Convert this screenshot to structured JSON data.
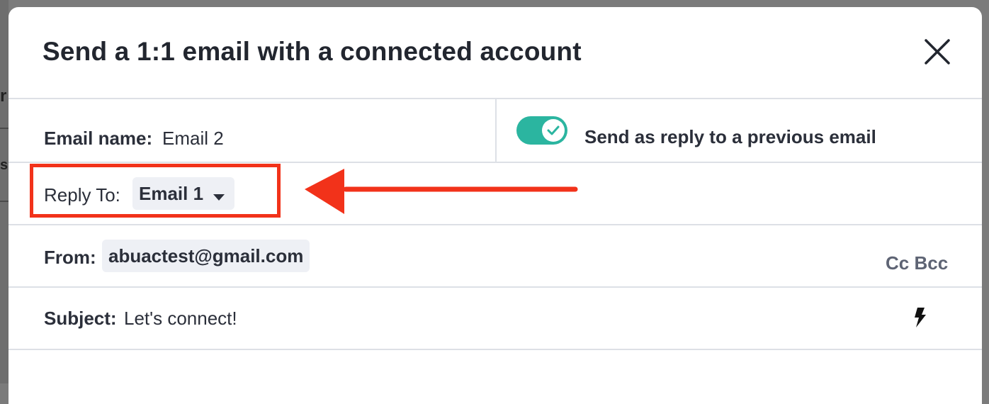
{
  "dialog": {
    "title": "Send a 1:1 email with a connected account",
    "close_icon": "close-icon"
  },
  "email_name": {
    "label": "Email name:",
    "value": "Email 2"
  },
  "reply_toggle": {
    "label": "Send as reply to a previous email",
    "enabled": true,
    "color": "#2bb5a0"
  },
  "reply_to": {
    "label": "Reply To:",
    "selected": "Email 1",
    "caret_icon": "caret-down-icon"
  },
  "from": {
    "label": "From:",
    "value": "abuactest@gmail.com",
    "cc_bcc": "Cc Bcc"
  },
  "subject": {
    "label": "Subject:",
    "value": "Let's connect!",
    "personalize_icon": "lightning-bolt-icon"
  },
  "annotation": {
    "color": "#f2321a",
    "box_icon": "highlight-box",
    "arrow_icon": "arrow-left-icon"
  },
  "backdrop": {
    "chars": [
      "r",
      "s"
    ]
  }
}
